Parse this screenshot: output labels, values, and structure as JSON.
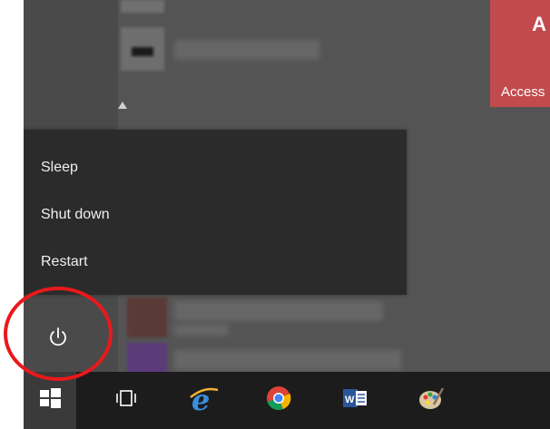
{
  "power_menu": {
    "items": [
      {
        "label": "Sleep"
      },
      {
        "label": "Shut down"
      },
      {
        "label": "Restart"
      }
    ]
  },
  "tiles": {
    "red_tile_label": "Access",
    "red_tile_letter": "A"
  },
  "colors": {
    "start_background": "#545454",
    "power_menu_background": "#2b2b2b",
    "taskbar_background": "#1c1c1c",
    "highlight_circle": "#e8191c",
    "access_tile": "#c24a4d"
  },
  "icons": {
    "power": "power-icon",
    "start": "windows-logo-icon",
    "task_view": "task-view-icon",
    "edge": "internet-explorer-icon",
    "chrome": "chrome-icon",
    "word": "word-icon",
    "paint": "paint-icon"
  }
}
